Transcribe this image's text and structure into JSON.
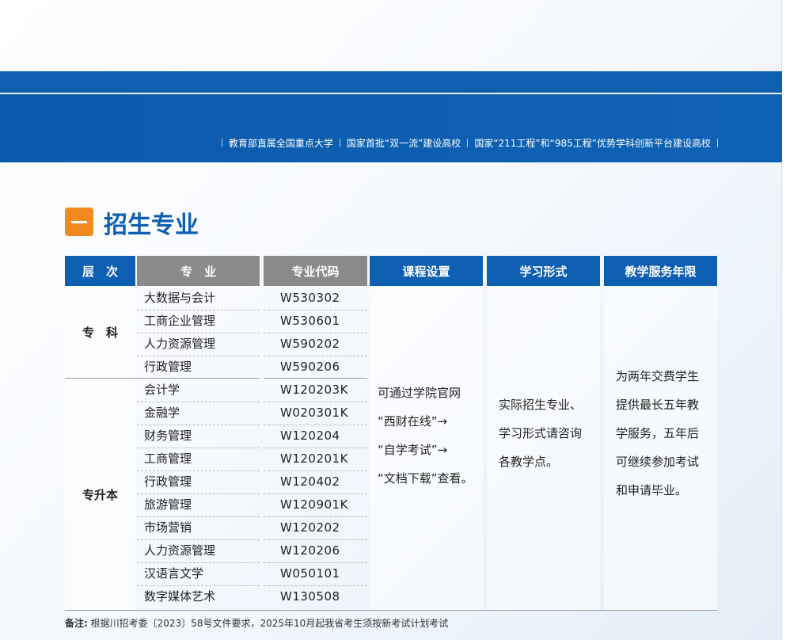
{
  "header": {
    "taglines": [
      "教育部直属全国重点大学",
      "国家首批“双一流”建设高校",
      "国家“211工程”和“985工程”优势学科创新平台建设高校"
    ]
  },
  "section": {
    "title": "招生专业"
  },
  "table": {
    "headers": [
      "层　次",
      "专　业",
      "专业代码",
      "课程设置",
      "学习形式",
      "教学服务年限"
    ],
    "levels": {
      "zhuanke": "专　科",
      "zhuanshengben": "专升本"
    },
    "rows": [
      {
        "major": "大数据与会计",
        "code": "W530302"
      },
      {
        "major": "工商企业管理",
        "code": "W530601"
      },
      {
        "major": "人力资源管理",
        "code": "W590202"
      },
      {
        "major": "行政管理",
        "code": "W590206"
      },
      {
        "major": "会计学",
        "code": "W120203K"
      },
      {
        "major": "金融学",
        "code": "W020301K"
      },
      {
        "major": "财务管理",
        "code": "W120204"
      },
      {
        "major": "工商管理",
        "code": "W120201K"
      },
      {
        "major": "行政管理",
        "code": "W120402"
      },
      {
        "major": "旅游管理",
        "code": "W120901K"
      },
      {
        "major": "市场营销",
        "code": "W120202"
      },
      {
        "major": "人力资源管理",
        "code": "W120206"
      },
      {
        "major": "汉语言文学",
        "code": "W050101"
      },
      {
        "major": "数字媒体艺术",
        "code": "W130508"
      }
    ],
    "course_setup": [
      "可通过学院官网",
      "“西财在线”→",
      "“自学考试”→",
      "“文档下载”查看。"
    ],
    "study_form": [
      "实际招生专业、",
      "学习形式请咨询",
      "各教学点。"
    ],
    "service_years": [
      "为两年交费学生",
      "提供最长五年教",
      "学服务，五年后",
      "可继续参加考试",
      "和申请毕业。"
    ]
  },
  "footnote": {
    "label": "备注:",
    "text": "根据川招考委〔2023〕58号文件要求，2025年10月起我省考生须按新考试计划考试"
  }
}
